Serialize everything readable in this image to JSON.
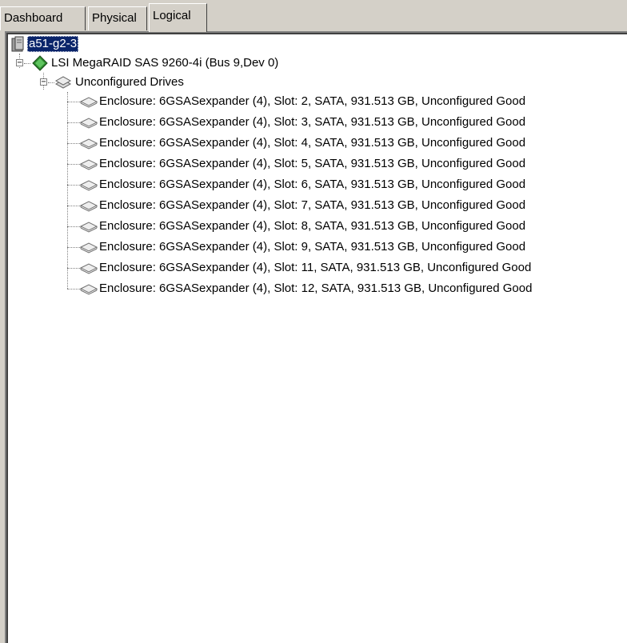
{
  "tabs": [
    {
      "label": "Dashboard",
      "active": false
    },
    {
      "label": "Physical",
      "active": false
    },
    {
      "label": "Logical",
      "active": true
    }
  ],
  "tree": {
    "root": {
      "label": "a51-g2-3",
      "icon": "server-icon",
      "selected": true
    },
    "controller": {
      "label": "LSI MegaRAID SAS 9260-4i (Bus 9,Dev 0)",
      "icon": "controller-diamond-icon",
      "expander": "−"
    },
    "group": {
      "label": "Unconfigured Drives",
      "icon": "drive-group-icon",
      "expander": "−"
    },
    "drives": [
      {
        "label": "Enclosure: 6GSASexpander (4), Slot: 2, SATA, 931.513 GB, Unconfigured Good"
      },
      {
        "label": "Enclosure: 6GSASexpander (4), Slot: 3, SATA, 931.513 GB, Unconfigured Good"
      },
      {
        "label": "Enclosure: 6GSASexpander (4), Slot: 4, SATA, 931.513 GB, Unconfigured Good"
      },
      {
        "label": "Enclosure: 6GSASexpander (4), Slot: 5, SATA, 931.513 GB, Unconfigured Good"
      },
      {
        "label": "Enclosure: 6GSASexpander (4), Slot: 6, SATA, 931.513 GB, Unconfigured Good"
      },
      {
        "label": "Enclosure: 6GSASexpander (4), Slot: 7, SATA, 931.513 GB, Unconfigured Good"
      },
      {
        "label": "Enclosure: 6GSASexpander (4), Slot: 8, SATA, 931.513 GB, Unconfigured Good"
      },
      {
        "label": "Enclosure: 6GSASexpander (4), Slot: 9, SATA, 931.513 GB, Unconfigured Good"
      },
      {
        "label": "Enclosure: 6GSASexpander (4), Slot: 11, SATA, 931.513 GB, Unconfigured Good"
      },
      {
        "label": "Enclosure: 6GSASexpander (4), Slot: 12, SATA, 931.513 GB, Unconfigured Good"
      }
    ]
  },
  "colors": {
    "selection": "#0a246a",
    "face": "#d4d0c8",
    "controller_icon": "#2e8b2e"
  }
}
